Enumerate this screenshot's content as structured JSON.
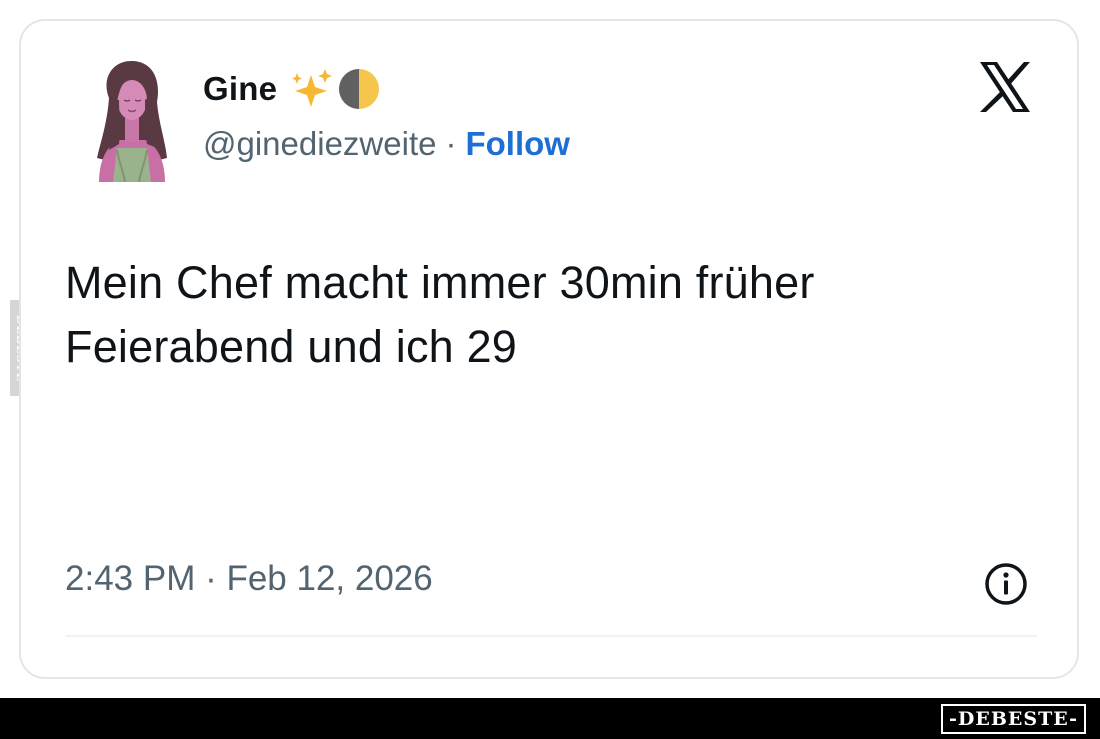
{
  "tweet": {
    "author": {
      "display_name": "Gine",
      "name_emojis": [
        "sparkles-emoji",
        "first-quarter-moon-emoji"
      ],
      "handle": "@ginediezweite",
      "separator": "·",
      "follow_label": "Follow",
      "avatar_icon": "woman-portrait-avatar"
    },
    "platform_icon": "x-logo-icon",
    "text_lines": [
      "Mein Chef macht immer 30min früher",
      "Feierabend und ich 29"
    ],
    "timestamp": "2:43 PM · Feb 12, 2026",
    "info_icon": "info-icon"
  },
  "watermark": {
    "side_text": "DEBESTE",
    "bottom_text": "-DEBESTE-"
  },
  "colors": {
    "link_blue": "#1d6fd6",
    "text_primary": "#0f1419",
    "text_secondary": "#536471",
    "card_border": "#e3e6e9",
    "bottom_bar": "#000000"
  }
}
